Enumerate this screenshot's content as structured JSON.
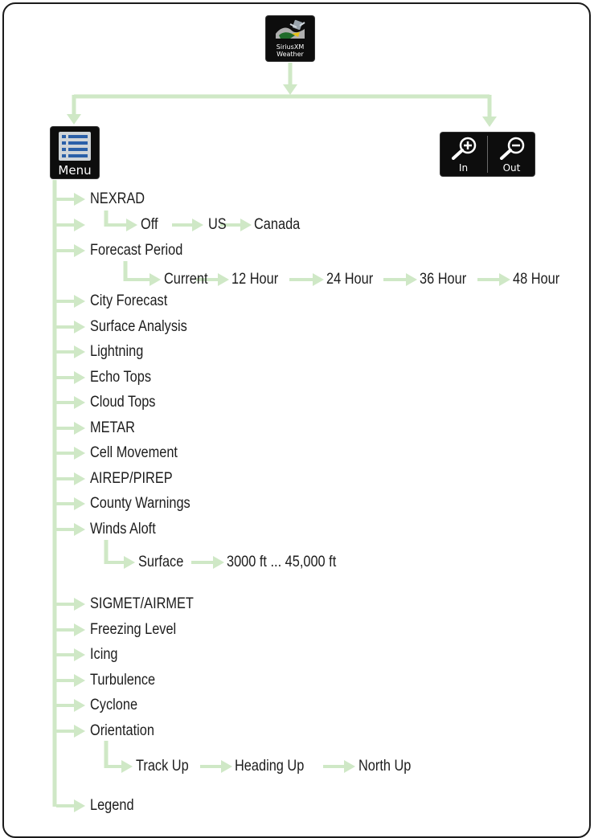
{
  "colors": {
    "connector": "#cfe8c6",
    "button_bg": "#0d0d0d",
    "text": "#1d1d1d"
  },
  "top_button": {
    "icon": "siriusxm-weather-icon",
    "line1": "SiriusXM",
    "line2": "Weather"
  },
  "menu_button": {
    "icon": "menu-list-icon",
    "label": "Menu"
  },
  "zoom": {
    "in_label": "In",
    "out_label": "Out",
    "in_icon": "zoom-in-icon",
    "out_icon": "zoom-out-icon"
  },
  "menu_items": [
    {
      "label": "NEXRAD"
    },
    {
      "label": ""
    },
    {
      "label": "Forecast Period"
    },
    {
      "label": "City Forecast"
    },
    {
      "label": "Surface Analysis"
    },
    {
      "label": "Lightning"
    },
    {
      "label": "Echo Tops"
    },
    {
      "label": "Cloud Tops"
    },
    {
      "label": "METAR"
    },
    {
      "label": "Cell Movement"
    },
    {
      "label": "AIREP/PIREP"
    },
    {
      "label": "County Warnings"
    },
    {
      "label": "Winds Aloft"
    },
    {
      "label": "SIGMET/AIRMET"
    },
    {
      "label": "Freezing Level"
    },
    {
      "label": "Icing"
    },
    {
      "label": "Turbulence"
    },
    {
      "label": "Cyclone"
    },
    {
      "label": "Orientation"
    },
    {
      "label": "Legend"
    }
  ],
  "sub_options": {
    "nexrad": [
      "Off",
      "US",
      "Canada"
    ],
    "forecast_period": [
      "Current",
      "12 Hour",
      "24 Hour",
      "36 Hour",
      "48 Hour"
    ],
    "winds_aloft": [
      "Surface",
      "3000 ft ... 45,000 ft"
    ],
    "orientation": [
      "Track Up",
      "Heading Up",
      "North Up"
    ]
  }
}
